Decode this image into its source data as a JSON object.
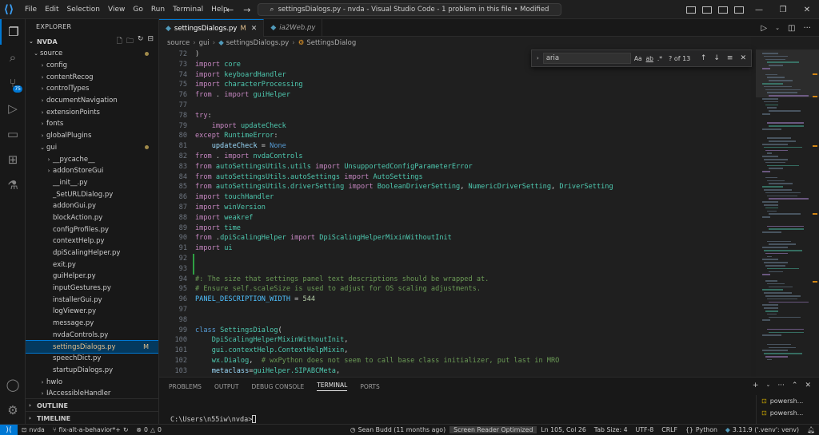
{
  "titlebar": {
    "menu": [
      "File",
      "Edit",
      "Selection",
      "View",
      "Go",
      "Run",
      "Terminal",
      "Help"
    ],
    "command_center": "settingsDialogs.py - nvda - Visual Studio Code - 1 problem in this file • Modified"
  },
  "explorer": {
    "title": "EXPLORER",
    "root": "NVDA",
    "items": [
      {
        "label": "source",
        "indent": 1,
        "twist": "v",
        "status": "dot"
      },
      {
        "label": "config",
        "indent": 2,
        "twist": ">"
      },
      {
        "label": "contentRecog",
        "indent": 2,
        "twist": ">"
      },
      {
        "label": "controlTypes",
        "indent": 2,
        "twist": ">"
      },
      {
        "label": "documentNavigation",
        "indent": 2,
        "twist": ">"
      },
      {
        "label": "extensionPoints",
        "indent": 2,
        "twist": ">"
      },
      {
        "label": "fonts",
        "indent": 2,
        "twist": ">"
      },
      {
        "label": "globalPlugins",
        "indent": 2,
        "twist": ">"
      },
      {
        "label": "gui",
        "indent": 2,
        "twist": "v",
        "status": "dot"
      },
      {
        "label": "__pycache__",
        "indent": 3,
        "twist": ">"
      },
      {
        "label": "addonStoreGui",
        "indent": 3,
        "twist": ">"
      },
      {
        "label": "__init__.py",
        "indent": 3
      },
      {
        "label": "_SetURLDialog.py",
        "indent": 3
      },
      {
        "label": "addonGui.py",
        "indent": 3
      },
      {
        "label": "blockAction.py",
        "indent": 3
      },
      {
        "label": "configProfiles.py",
        "indent": 3
      },
      {
        "label": "contextHelp.py",
        "indent": 3
      },
      {
        "label": "dpiScalingHelper.py",
        "indent": 3
      },
      {
        "label": "exit.py",
        "indent": 3
      },
      {
        "label": "guiHelper.py",
        "indent": 3
      },
      {
        "label": "inputGestures.py",
        "indent": 3
      },
      {
        "label": "installerGui.py",
        "indent": 3
      },
      {
        "label": "logViewer.py",
        "indent": 3
      },
      {
        "label": "message.py",
        "indent": 3
      },
      {
        "label": "nvdaControls.py",
        "indent": 3
      },
      {
        "label": "settingsDialogs.py",
        "indent": 3,
        "selected": true,
        "status": "M"
      },
      {
        "label": "speechDict.py",
        "indent": 3
      },
      {
        "label": "startupDialogs.py",
        "indent": 3
      },
      {
        "label": "hwIo",
        "indent": 2,
        "twist": ">"
      },
      {
        "label": "IAccessibleHandler",
        "indent": 2,
        "twist": ">"
      }
    ],
    "outline": "OUTLINE",
    "timeline": "TIMELINE"
  },
  "tabs": [
    {
      "label": "settingsDialogs.py",
      "modified": "M",
      "active": true
    },
    {
      "label": "ia2Web.py",
      "active": false
    }
  ],
  "breadcrumb": [
    "source",
    "gui",
    "settingsDialogs.py",
    "SettingsDialog"
  ],
  "find": {
    "query": "aria",
    "opts": [
      "Aa",
      "ab",
      ".*"
    ],
    "count": "? of 13"
  },
  "code": [
    {
      "n": "72",
      "t": [
        [
          "src",
          ")"
        ]
      ]
    },
    {
      "n": "73",
      "t": [
        [
          "kw2",
          "import"
        ],
        [
          "src",
          " "
        ],
        [
          "mod-name",
          "core"
        ]
      ]
    },
    {
      "n": "74",
      "t": [
        [
          "kw2",
          "import"
        ],
        [
          "src",
          " "
        ],
        [
          "mod-name",
          "keyboardHandler"
        ]
      ]
    },
    {
      "n": "75",
      "t": [
        [
          "kw2",
          "import"
        ],
        [
          "src",
          " "
        ],
        [
          "mod-name",
          "characterProcessing"
        ]
      ]
    },
    {
      "n": "76",
      "t": [
        [
          "kw2",
          "from"
        ],
        [
          "src",
          " . "
        ],
        [
          "kw2",
          "import"
        ],
        [
          "src",
          " "
        ],
        [
          "mod-name",
          "guiHelper"
        ]
      ]
    },
    {
      "n": "77",
      "t": []
    },
    {
      "n": "78",
      "t": [
        [
          "kw2",
          "try"
        ],
        [
          "src",
          ":"
        ]
      ]
    },
    {
      "n": "79",
      "t": [
        [
          "src",
          "    "
        ],
        [
          "kw2",
          "import"
        ],
        [
          "src",
          " "
        ],
        [
          "mod-name",
          "updateCheck"
        ]
      ]
    },
    {
      "n": "80",
      "t": [
        [
          "kw2",
          "except"
        ],
        [
          "src",
          " "
        ],
        [
          "mod-name",
          "RuntimeError"
        ],
        [
          "src",
          ":"
        ]
      ]
    },
    {
      "n": "81",
      "t": [
        [
          "src",
          "    "
        ],
        [
          "var",
          "updateCheck"
        ],
        [
          "src",
          " = "
        ],
        [
          "kw",
          "None"
        ]
      ]
    },
    {
      "n": "82",
      "t": [
        [
          "kw2",
          "from"
        ],
        [
          "src",
          " . "
        ],
        [
          "kw2",
          "import"
        ],
        [
          "src",
          " "
        ],
        [
          "mod-name",
          "nvdaControls"
        ]
      ]
    },
    {
      "n": "83",
      "t": [
        [
          "kw2",
          "from"
        ],
        [
          "src",
          " "
        ],
        [
          "mod-name",
          "autoSettingsUtils.utils"
        ],
        [
          "src",
          " "
        ],
        [
          "kw2",
          "import"
        ],
        [
          "src",
          " "
        ],
        [
          "mod-name",
          "UnsupportedConfigParameterError"
        ]
      ]
    },
    {
      "n": "84",
      "t": [
        [
          "kw2",
          "from"
        ],
        [
          "src",
          " "
        ],
        [
          "mod-name",
          "autoSettingsUtils.autoSettings"
        ],
        [
          "src",
          " "
        ],
        [
          "kw2",
          "import"
        ],
        [
          "src",
          " "
        ],
        [
          "mod-name",
          "AutoSettings"
        ]
      ]
    },
    {
      "n": "85",
      "t": [
        [
          "kw2",
          "from"
        ],
        [
          "src",
          " "
        ],
        [
          "mod-name",
          "autoSettingsUtils.driverSetting"
        ],
        [
          "src",
          " "
        ],
        [
          "kw2",
          "import"
        ],
        [
          "src",
          " "
        ],
        [
          "mod-name",
          "BooleanDriverSetting"
        ],
        [
          "src",
          ", "
        ],
        [
          "mod-name",
          "NumericDriverSetting"
        ],
        [
          "src",
          ", "
        ],
        [
          "mod-name",
          "DriverSetting"
        ]
      ]
    },
    {
      "n": "86",
      "t": [
        [
          "kw2",
          "import"
        ],
        [
          "src",
          " "
        ],
        [
          "mod-name",
          "touchHandler"
        ]
      ]
    },
    {
      "n": "87",
      "t": [
        [
          "kw2",
          "import"
        ],
        [
          "src",
          " "
        ],
        [
          "mod-name",
          "winVersion"
        ]
      ]
    },
    {
      "n": "88",
      "t": [
        [
          "kw2",
          "import"
        ],
        [
          "src",
          " "
        ],
        [
          "mod-name",
          "weakref"
        ]
      ]
    },
    {
      "n": "89",
      "t": [
        [
          "kw2",
          "import"
        ],
        [
          "src",
          " "
        ],
        [
          "mod-name",
          "time"
        ]
      ]
    },
    {
      "n": "90",
      "t": [
        [
          "kw2",
          "from"
        ],
        [
          "src",
          " ."
        ],
        [
          "mod-name",
          "dpiScalingHelper"
        ],
        [
          "src",
          " "
        ],
        [
          "kw2",
          "import"
        ],
        [
          "src",
          " "
        ],
        [
          "mod-name",
          "DpiScalingHelperMixinWithoutInit"
        ]
      ]
    },
    {
      "n": "91",
      "t": [
        [
          "kw2",
          "import"
        ],
        [
          "src",
          " "
        ],
        [
          "mod-name",
          "ui"
        ]
      ]
    },
    {
      "n": "92",
      "t": []
    },
    {
      "n": "93",
      "t": []
    },
    {
      "n": "94",
      "t": [
        [
          "cmt",
          "#: The size that settings panel text descriptions should be wrapped at."
        ]
      ]
    },
    {
      "n": "95",
      "t": [
        [
          "cmt",
          "# Ensure self.scaleSize is used to adjust for OS scaling adjustments."
        ]
      ]
    },
    {
      "n": "96",
      "t": [
        [
          "const",
          "PANEL_DESCRIPTION_WIDTH"
        ],
        [
          "src",
          " = "
        ],
        [
          "num",
          "544"
        ]
      ]
    },
    {
      "n": "97",
      "t": []
    },
    {
      "n": "98",
      "t": []
    },
    {
      "n": "99",
      "t": [
        [
          "kw",
          "class"
        ],
        [
          "src",
          " "
        ],
        [
          "mod-name",
          "SettingsDialog"
        ],
        [
          "src",
          "("
        ]
      ]
    },
    {
      "n": "100",
      "t": [
        [
          "src",
          "    "
        ],
        [
          "mod-name",
          "DpiScalingHelperMixinWithoutInit"
        ],
        [
          "src",
          ","
        ]
      ]
    },
    {
      "n": "101",
      "t": [
        [
          "src",
          "    "
        ],
        [
          "mod-name",
          "gui.contextHelp.ContextHelpMixin"
        ],
        [
          "src",
          ","
        ]
      ]
    },
    {
      "n": "102",
      "t": [
        [
          "src",
          "    "
        ],
        [
          "mod-name",
          "wx.Dialog"
        ],
        [
          "src",
          ",  "
        ],
        [
          "cmt",
          "# wxPython does not seem to call base class initializer, put last in MRO"
        ]
      ]
    },
    {
      "n": "103",
      "t": [
        [
          "src",
          "    "
        ],
        [
          "var",
          "metaclass"
        ],
        [
          "src",
          "="
        ],
        [
          "mod-name",
          "guiHelper.SIPABCMeta"
        ],
        [
          "src",
          ","
        ]
      ]
    },
    {
      "n": "104",
      "t": [
        [
          "src",
          "):"
        ]
      ]
    }
  ],
  "panel": {
    "tabs": [
      "PROBLEMS",
      "OUTPUT",
      "DEBUG CONSOLE",
      "TERMINAL",
      "PORTS"
    ],
    "active_tab": "TERMINAL",
    "prompt": "C:\\Users\\n55iw\\nvda>",
    "terminals": [
      "powersh...",
      "powersh..."
    ]
  },
  "statusbar": {
    "branch": "nvda",
    "sync": "fix-alt-a-behavior*+",
    "errors": "0",
    "warnings": "0",
    "blame": "Sean Budd (11 months ago)",
    "screen_reader": "Screen Reader Optimized",
    "position": "Ln 105, Col 26",
    "tab_size": "Tab Size: 4",
    "encoding": "UTF-8",
    "eol": "CRLF",
    "language": "Python",
    "interpreter": "3.11.9 ('.venv': venv)"
  },
  "badges": {
    "scm": "75"
  }
}
